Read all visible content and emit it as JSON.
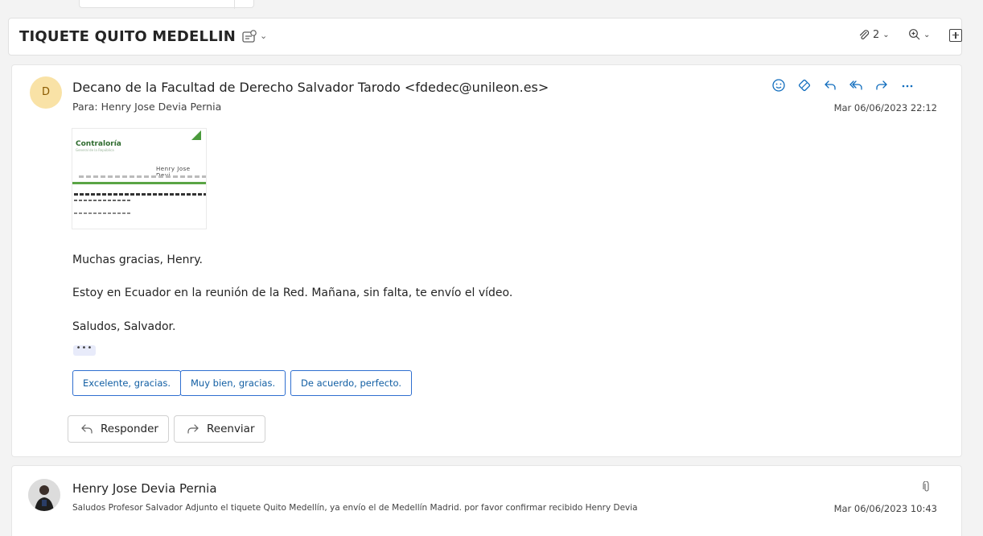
{
  "thread": {
    "subject": "TIQUETE QUITO MEDELLIN",
    "attachment_count": "2"
  },
  "message1": {
    "avatar_initial": "D",
    "sender": "Decano de la Facultad de Derecho Salvador Tarodo <fdedec@unileon.es>",
    "to": "Para:  Henry Jose Devia Pernia",
    "date": "Mar 06/06/2023 22:12",
    "body": [
      "Muchas gracias, Henry.",
      "Estoy en Ecuador en la reunión de la Red. Mañana, sin falta, te envío el vídeo.",
      "Saludos, Salvador."
    ],
    "more_dots": "•••",
    "quick_replies": [
      "Excelente, gracias.",
      "Muy bien, gracias.",
      "De acuerdo, perfecto."
    ],
    "reply_label": "Responder",
    "forward_label": "Reenviar"
  },
  "message2": {
    "sender": "Henry Jose Devia Pernia",
    "preview": "Saludos Profesor Salvador Adjunto el tiquete Quito Medellín, ya envío el de Medellín Madrid. por favor confirmar recibido Henry Devia",
    "date": "Mar 06/06/2023 10:43"
  },
  "colors": {
    "accent": "#0f6cbd",
    "avatar_bg": "#f9e2a6",
    "quick_reply_border": "#2f6fd0"
  },
  "icons": [
    "save-to-category-icon",
    "paperclip-icon",
    "zoom-icon",
    "expand-icon",
    "emoji-icon",
    "sticker-icon",
    "reply-icon",
    "reply-all-icon",
    "forward-icon",
    "more-icon"
  ]
}
